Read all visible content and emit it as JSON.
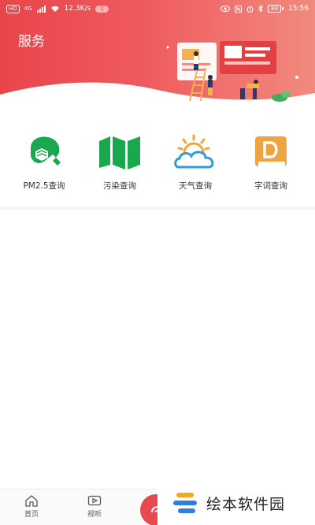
{
  "status_bar": {
    "hd": "HD",
    "network": "4G",
    "speed": "12.3K/s",
    "notification_count": "2",
    "battery": "88",
    "time": "15:56"
  },
  "header": {
    "title": "服务"
  },
  "services": [
    {
      "label": "PM2.5查询",
      "icon": "mask-icon",
      "color": "#1aa84f"
    },
    {
      "label": "污染查询",
      "icon": "map-icon",
      "color": "#1aa84f"
    },
    {
      "label": "天气查询",
      "icon": "weather-icon",
      "color": "#2f9be0"
    },
    {
      "label": "字词查询",
      "icon": "dictionary-icon",
      "color": "#f0a440"
    }
  ],
  "bottom_nav": {
    "home_label": "首页",
    "video_label": "视听"
  },
  "watermark": {
    "text": "绘本软件园"
  },
  "colors": {
    "header_start": "#e8454a",
    "header_end": "#f28a7e",
    "green": "#1aa84f",
    "blue": "#2f9be0",
    "orange": "#f0a440"
  }
}
